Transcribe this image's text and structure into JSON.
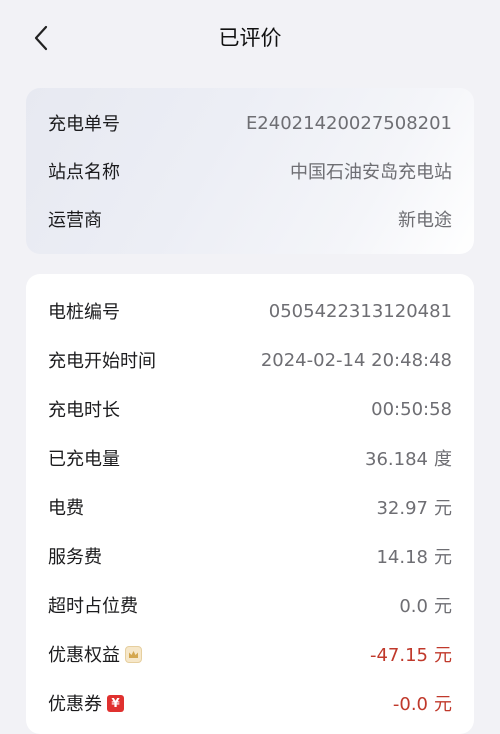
{
  "header": {
    "title": "已评价",
    "back_icon": "chevron-left-icon"
  },
  "order_card": {
    "rows": [
      {
        "label": "充电单号",
        "value": "E24021420027508201"
      },
      {
        "label": "站点名称",
        "value": "中国石油安岛充电站"
      },
      {
        "label": "运营商",
        "value": "新电途"
      }
    ]
  },
  "detail_card": {
    "rows": [
      {
        "label": "电桩编号",
        "value": "0505422313120481",
        "unit": ""
      },
      {
        "label": "充电开始时间",
        "value": "2024-02-14 20:48:48",
        "unit": ""
      },
      {
        "label": "充电时长",
        "value": "00:50:58",
        "unit": ""
      },
      {
        "label": "已充电量",
        "value": "36.184",
        "unit": "度"
      },
      {
        "label": "电费",
        "value": "32.97",
        "unit": "元"
      },
      {
        "label": "服务费",
        "value": "14.18",
        "unit": "元"
      },
      {
        "label": "超时占位费",
        "value": "0.0",
        "unit": "元"
      },
      {
        "label": "优惠权益",
        "value": "-47.15",
        "unit": "元",
        "icon": "crown-badge-icon"
      },
      {
        "label": "优惠券",
        "value": "-0.0",
        "unit": "元",
        "icon": "coupon-badge-icon",
        "icon_text": "¥"
      }
    ]
  },
  "colors": {
    "background": "#f2f2f6",
    "discount_red": "#c0392b",
    "coupon_red": "#e0312f"
  }
}
